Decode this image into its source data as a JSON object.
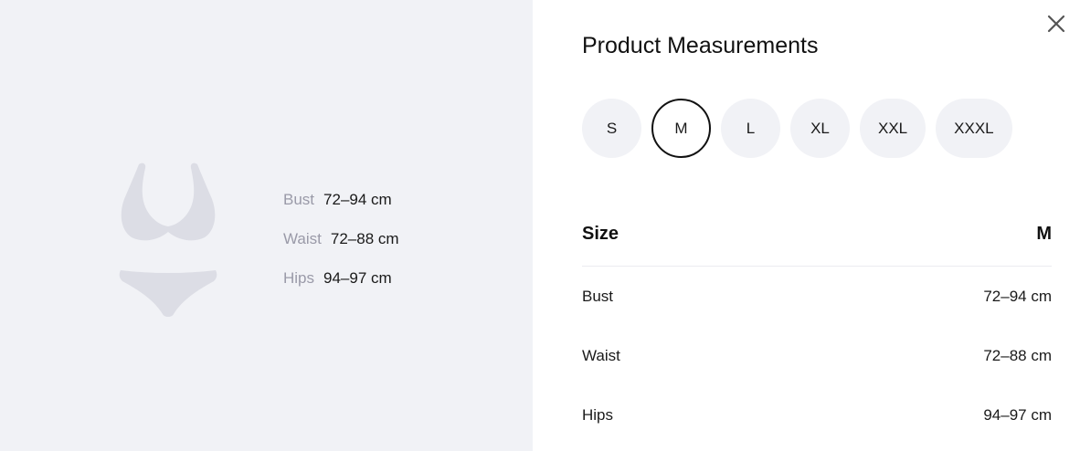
{
  "illustration": {
    "icon": "lingerie-icon",
    "color": "#dcdde5"
  },
  "summary": [
    {
      "label": "Bust",
      "value": "72–94 cm"
    },
    {
      "label": "Waist",
      "value": "72–88 cm"
    },
    {
      "label": "Hips",
      "value": "94–97 cm"
    }
  ],
  "panel": {
    "title": "Product Measurements",
    "close_icon": "close-icon",
    "sizes": [
      {
        "label": "S",
        "selected": false
      },
      {
        "label": "M",
        "selected": true
      },
      {
        "label": "L",
        "selected": false
      },
      {
        "label": "XL",
        "selected": false
      },
      {
        "label": "XXL",
        "selected": false
      },
      {
        "label": "XXXL",
        "selected": false
      }
    ],
    "table": {
      "header_label": "Size",
      "header_value": "M",
      "rows": [
        {
          "label": "Bust",
          "value": "72–94 cm"
        },
        {
          "label": "Waist",
          "value": "72–88 cm"
        },
        {
          "label": "Hips",
          "value": "94–97 cm"
        }
      ]
    }
  },
  "colors": {
    "left_background": "#f1f2f6",
    "pill_background": "#f1f2f6",
    "selected_border": "#111111",
    "muted_text": "#9a9aa8"
  }
}
